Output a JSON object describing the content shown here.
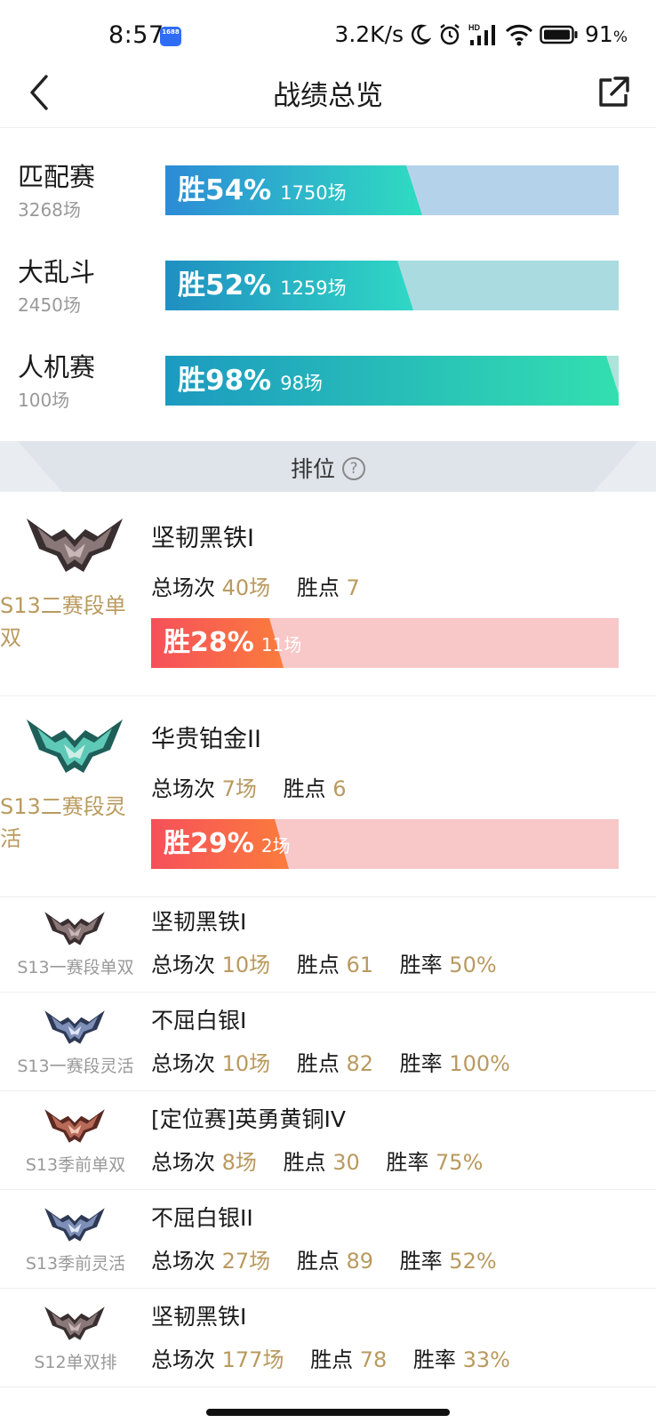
{
  "status_bar": {
    "time": "8:57",
    "app_badge": "1688",
    "net_speed": "3.2K/s",
    "hd_label": "HD",
    "battery": "91",
    "battery_unit": "%"
  },
  "header": {
    "title": "战绩总览"
  },
  "overview": [
    {
      "name": "匹配赛",
      "count": "3268场",
      "win_label": "胜54%",
      "win_games": "1750场",
      "win_rate": 54,
      "fill_start": "#2c8bd6",
      "fill_end": "#2fdcc0",
      "track": "#b4d3ea"
    },
    {
      "name": "大乱斗",
      "count": "2450场",
      "win_label": "胜52%",
      "win_games": "1259场",
      "win_rate": 52,
      "fill_start": "#1f8fc2",
      "fill_end": "#30d8c5",
      "track": "#aadbe0"
    },
    {
      "name": "人机赛",
      "count": "100场",
      "win_label": "胜98%",
      "win_games": "98场",
      "win_rate": 98,
      "fill_start": "#1c9ac0",
      "fill_end": "#33e0b0",
      "track": "#ace4da"
    }
  ],
  "ranked_section": {
    "title": "排位",
    "help": "?"
  },
  "labels": {
    "total": "总场次",
    "points": "胜点",
    "rate": "胜率"
  },
  "ranked_big": [
    {
      "queue": "S13二赛段单双",
      "rank": "坚韧黑铁I",
      "total": "40场",
      "points": "7",
      "win_label": "胜28%",
      "win_games": "11场",
      "win_rate": 28,
      "emblem": "iron-emblem"
    },
    {
      "queue": "S13二赛段灵活",
      "rank": "华贵铂金II",
      "total": "7场",
      "points": "6",
      "win_label": "胜29%",
      "win_games": "2场",
      "win_rate": 29,
      "emblem": "platinum-emblem"
    }
  ],
  "ranked_small": [
    {
      "queue": "S13一赛段单双",
      "rank": "坚韧黑铁I",
      "total": "10场",
      "points": "61",
      "rate": "50%",
      "emblem": "iron-emblem"
    },
    {
      "queue": "S13一赛段灵活",
      "rank": "不屈白银I",
      "total": "10场",
      "points": "82",
      "rate": "100%",
      "emblem": "silver-emblem"
    },
    {
      "queue": "S13季前单双",
      "rank": "[定位赛]英勇黄铜IV",
      "total": "8场",
      "points": "30",
      "rate": "75%",
      "emblem": "bronze-emblem"
    },
    {
      "queue": "S13季前灵活",
      "rank": "不屈白银II",
      "total": "27场",
      "points": "89",
      "rate": "52%",
      "emblem": "silver-emblem"
    },
    {
      "queue": "S12单双排",
      "rank": "坚韧黑铁I",
      "total": "177场",
      "points": "78",
      "rate": "33%",
      "emblem": "iron-emblem"
    }
  ],
  "colors": {
    "accent_gold": "#b99a5f",
    "loss_track": "#f8c7c8",
    "win_red": "#f6505a"
  }
}
